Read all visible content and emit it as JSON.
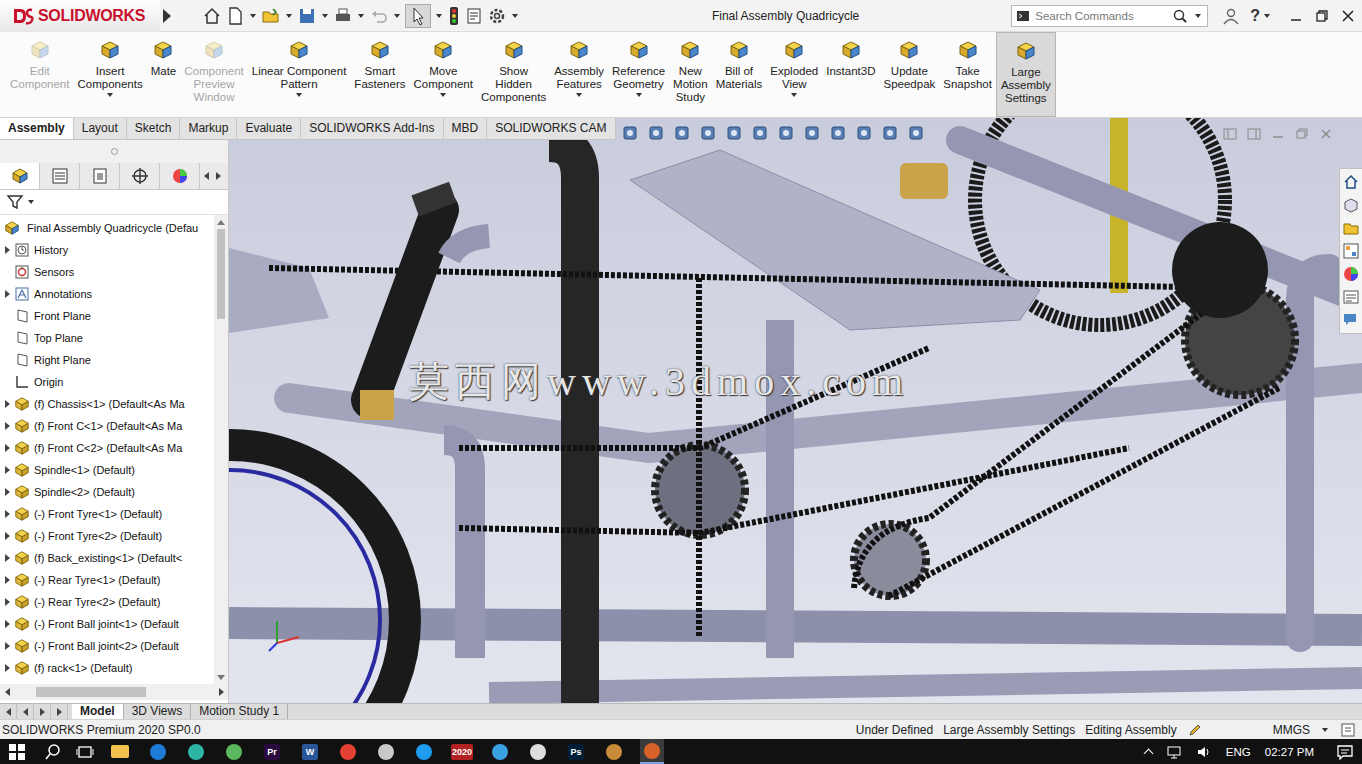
{
  "window": {
    "title": "Final Assembly Quadricycle",
    "help": "?"
  },
  "logo": {
    "text": "SOLIDWORKS"
  },
  "search": {
    "placeholder": "Search Commands"
  },
  "ribbon": {
    "buttons": [
      {
        "lines": [
          "Edit",
          "Component"
        ],
        "disabled": true,
        "selected": false,
        "dropdown": false
      },
      {
        "lines": [
          "Insert",
          "Components"
        ],
        "disabled": false,
        "selected": false,
        "dropdown": true
      },
      {
        "lines": [
          "Mate"
        ],
        "disabled": false,
        "selected": false,
        "dropdown": false
      },
      {
        "lines": [
          "Component",
          "Preview",
          "Window"
        ],
        "disabled": true,
        "selected": false,
        "dropdown": false
      },
      {
        "lines": [
          "Linear Component",
          "Pattern"
        ],
        "disabled": false,
        "selected": false,
        "dropdown": true
      },
      {
        "lines": [
          "Smart",
          "Fasteners"
        ],
        "disabled": false,
        "selected": false,
        "dropdown": false
      },
      {
        "lines": [
          "Move",
          "Component"
        ],
        "disabled": false,
        "selected": false,
        "dropdown": true
      },
      {
        "lines": [
          "Show",
          "Hidden",
          "Components"
        ],
        "disabled": false,
        "selected": false,
        "dropdown": false
      },
      {
        "lines": [
          "Assembly",
          "Features"
        ],
        "disabled": false,
        "selected": false,
        "dropdown": true
      },
      {
        "lines": [
          "Reference",
          "Geometry"
        ],
        "disabled": false,
        "selected": false,
        "dropdown": true
      },
      {
        "lines": [
          "New",
          "Motion",
          "Study"
        ],
        "disabled": false,
        "selected": false,
        "dropdown": false
      },
      {
        "lines": [
          "Bill of",
          "Materials"
        ],
        "disabled": false,
        "selected": false,
        "dropdown": false
      },
      {
        "lines": [
          "Exploded",
          "View"
        ],
        "disabled": false,
        "selected": false,
        "dropdown": true
      },
      {
        "lines": [
          "Instant3D"
        ],
        "disabled": false,
        "selected": false,
        "dropdown": false
      },
      {
        "lines": [
          "Update",
          "Speedpak"
        ],
        "disabled": false,
        "selected": false,
        "dropdown": false
      },
      {
        "lines": [
          "Take",
          "Snapshot"
        ],
        "disabled": false,
        "selected": false,
        "dropdown": false
      },
      {
        "lines": [
          "Large",
          "Assembly",
          "Settings"
        ],
        "disabled": false,
        "selected": true,
        "dropdown": false
      }
    ]
  },
  "command_tabs": [
    {
      "label": "Assembly",
      "selected": true
    },
    {
      "label": "Layout",
      "selected": false
    },
    {
      "label": "Sketch",
      "selected": false
    },
    {
      "label": "Markup",
      "selected": false
    },
    {
      "label": "Evaluate",
      "selected": false
    },
    {
      "label": "SOLIDWORKS Add-Ins",
      "selected": false
    },
    {
      "label": "MBD",
      "selected": false
    },
    {
      "label": "SOLIDWORKS CAM",
      "selected": false
    }
  ],
  "feature_tree": {
    "root": {
      "label": "Final Assembly Quadricycle  (Defau"
    },
    "items": [
      {
        "label": "History",
        "kind": "history",
        "expandable": true,
        "expanded": false
      },
      {
        "label": "Sensors",
        "kind": "sensor",
        "expandable": false,
        "expanded": false
      },
      {
        "label": "Annotations",
        "kind": "annotation",
        "expandable": true,
        "expanded": false
      },
      {
        "label": "Front Plane",
        "kind": "plane",
        "expandable": false,
        "expanded": false
      },
      {
        "label": "Top Plane",
        "kind": "plane",
        "expandable": false,
        "expanded": false
      },
      {
        "label": "Right Plane",
        "kind": "plane",
        "expandable": false,
        "expanded": false
      },
      {
        "label": "Origin",
        "kind": "origin",
        "expandable": false,
        "expanded": false
      },
      {
        "label": "(f) Chassis<1> (Default<As Ma",
        "kind": "part",
        "expandable": true,
        "expanded": false
      },
      {
        "label": "(f) Front C<1> (Default<As Ma",
        "kind": "part",
        "expandable": true,
        "expanded": false
      },
      {
        "label": "(f) Front C<2> (Default<As Ma",
        "kind": "part",
        "expandable": true,
        "expanded": false
      },
      {
        "label": "Spindle<1> (Default)",
        "kind": "part",
        "expandable": true,
        "expanded": false
      },
      {
        "label": "Spindle<2> (Default)",
        "kind": "part",
        "expandable": true,
        "expanded": false
      },
      {
        "label": "(-) Front Tyre<1> (Default)",
        "kind": "part",
        "expandable": true,
        "expanded": false
      },
      {
        "label": "(-) Front Tyre<2> (Default)",
        "kind": "part",
        "expandable": true,
        "expanded": false
      },
      {
        "label": "(f) Back_existing<1> (Default<",
        "kind": "part",
        "expandable": true,
        "expanded": false
      },
      {
        "label": "(-) Rear Tyre<1> (Default)",
        "kind": "part",
        "expandable": true,
        "expanded": false
      },
      {
        "label": "(-) Rear Tyre<2> (Default)",
        "kind": "part",
        "expandable": true,
        "expanded": false
      },
      {
        "label": "(-) Front Ball joint<1> (Default",
        "kind": "part",
        "expandable": true,
        "expanded": false
      },
      {
        "label": "(-) Front Ball joint<2> (Default",
        "kind": "part",
        "expandable": true,
        "expanded": false
      },
      {
        "label": "(f) rack<1> (Default)",
        "kind": "part",
        "expandable": true,
        "expanded": false
      }
    ]
  },
  "watermark": "莫西网www.3dmox.com",
  "bottom_tabs": [
    {
      "label": "Model",
      "selected": true
    },
    {
      "label": "3D Views",
      "selected": false
    },
    {
      "label": "Motion Study 1",
      "selected": false
    }
  ],
  "status_bar": {
    "product": "SOLIDWORKS Premium 2020 SP0.0",
    "items": [
      "Under Defined",
      "Large Assembly Settings",
      "Editing Assembly"
    ],
    "units": "MMGS"
  },
  "taskbar": {
    "apps": [
      {
        "kind": "folder",
        "label": "",
        "color": "#f2c14e",
        "selected": false
      },
      {
        "kind": "circle",
        "label": "",
        "color": "#1e7bd6",
        "selected": false
      },
      {
        "kind": "circle",
        "label": "",
        "color": "#2fb5a5",
        "selected": false
      },
      {
        "kind": "circle",
        "label": "",
        "color": "#5cb85c",
        "selected": false
      },
      {
        "kind": "text",
        "label": "Pr",
        "color": "#2b0b3f",
        "selected": false
      },
      {
        "kind": "text",
        "label": "W",
        "color": "#2b579a",
        "selected": false
      },
      {
        "kind": "circle",
        "label": "",
        "color": "#e34133",
        "selected": false
      },
      {
        "kind": "circle",
        "label": "",
        "color": "#c8c8c8",
        "selected": false
      },
      {
        "kind": "circle",
        "label": "",
        "color": "#1f9cf0",
        "selected": false
      },
      {
        "kind": "text",
        "label": "2020",
        "color": "#b22222",
        "selected": false
      },
      {
        "kind": "circle",
        "label": "",
        "color": "#3aa0e0",
        "selected": false
      },
      {
        "kind": "circle",
        "label": "",
        "color": "#dddddd",
        "selected": false
      },
      {
        "kind": "text",
        "label": "Ps",
        "color": "#001e36",
        "selected": false
      },
      {
        "kind": "circle",
        "label": "",
        "color": "#c98a3a",
        "selected": false
      },
      {
        "kind": "circle",
        "label": "",
        "color": "#d9622b",
        "selected": true
      }
    ],
    "language": "ENG",
    "time": "02:27 PM"
  }
}
